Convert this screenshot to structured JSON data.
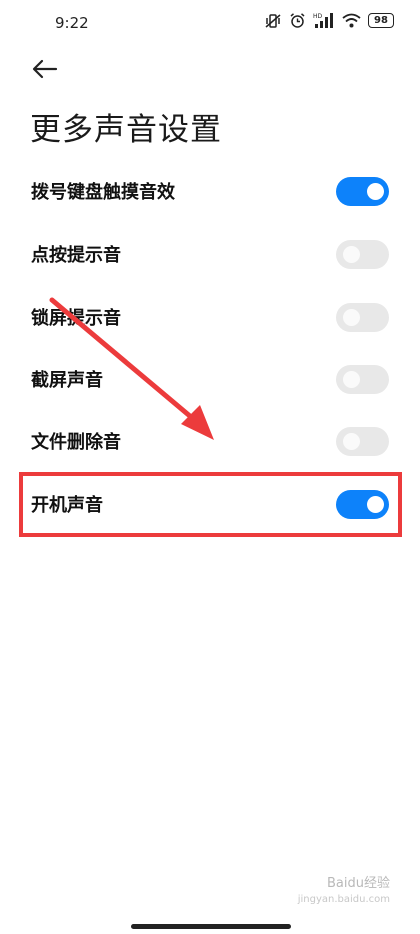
{
  "status_bar": {
    "time": "9:22",
    "icons": [
      "vibrate-off-icon",
      "alarm-icon",
      "hd-signal-icon",
      "wifi-icon"
    ],
    "hd_label": "HD",
    "battery": "98"
  },
  "header": {
    "back_icon": "arrow-left-icon",
    "title": "更多声音设置"
  },
  "settings": [
    {
      "label": "拨号键盘触摸音效",
      "enabled": true
    },
    {
      "label": "点按提示音",
      "enabled": false
    },
    {
      "label": "锁屏提示音",
      "enabled": false
    },
    {
      "label": "截屏声音",
      "enabled": false
    },
    {
      "label": "文件删除音",
      "enabled": false
    },
    {
      "label": "开机声音",
      "enabled": true
    }
  ],
  "colors": {
    "accent": "#0d82fa",
    "toggle_off": "#e8e8e8",
    "annotation": "#ec3b3c"
  },
  "watermark": {
    "main": "Baidu经验",
    "sub": "jingyan.baidu.com"
  }
}
